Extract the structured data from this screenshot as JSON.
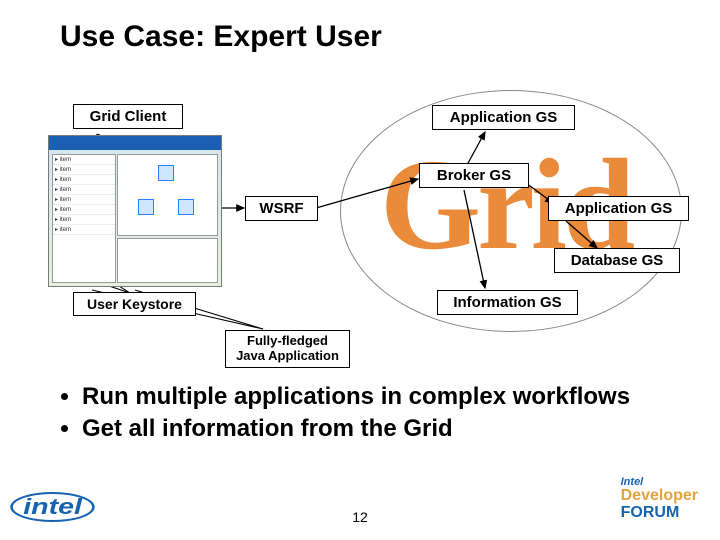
{
  "title": "Use Case: Expert User",
  "diagram": {
    "background_word": "Grid",
    "grid_client": "Grid Client",
    "user_keystore": "User Keystore",
    "wsrf": "WSRF",
    "fully_fledged_l1": "Fully-fledged",
    "fully_fledged_l2": "Java Application",
    "application_gs_1": "Application GS",
    "broker_gs": "Broker GS",
    "application_gs_2": "Application GS",
    "database_gs": "Database GS",
    "information_gs": "Information GS"
  },
  "bullets": [
    "Run multiple applications in complex workflows",
    "Get all information from the Grid"
  ],
  "page_number": "12",
  "logos": {
    "intel": "intel",
    "idf_intel": "Intel",
    "idf_developer": "Developer",
    "idf_forum": "FORUM"
  }
}
